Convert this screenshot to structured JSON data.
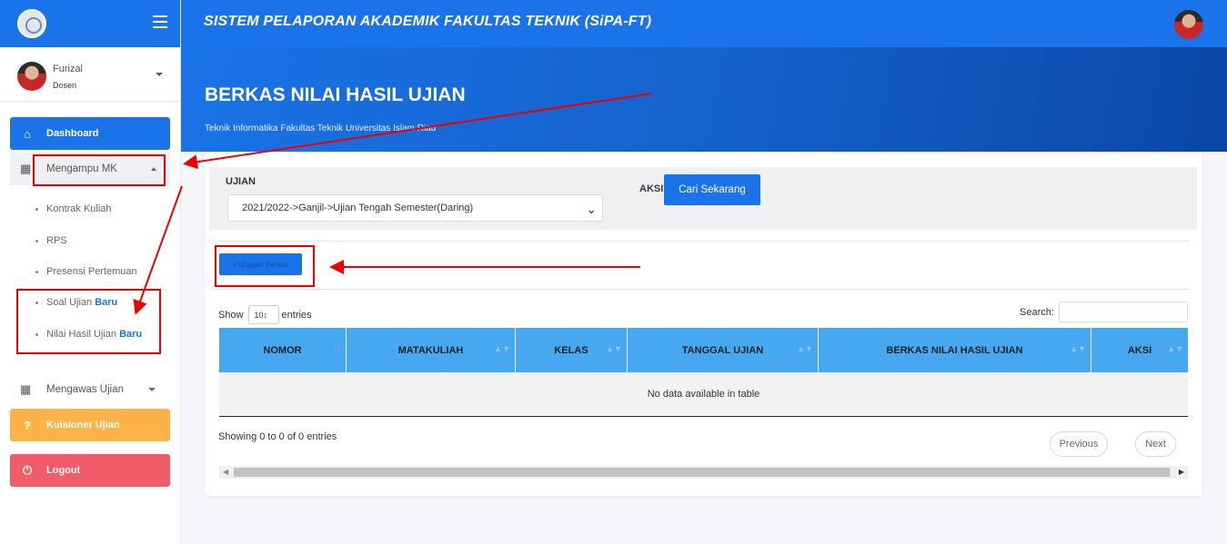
{
  "sidebar": {
    "user": {
      "name": "Furizal",
      "role": "Dosen"
    },
    "dashboard": "Dashboard",
    "mengampu": "Mengampu MK",
    "sub_items": [
      {
        "label": "Kontrak Kuliah"
      },
      {
        "label": "RPS"
      },
      {
        "label": "Presensi Pertemuan"
      },
      {
        "label": "Soal Ujian ",
        "badge": "Baru"
      },
      {
        "label": "Nilai Hasil Ujian ",
        "badge": "Baru"
      }
    ],
    "mengawas": "Mengawas Ujian",
    "kuisioner": "Kuisioner Ujian",
    "logout": "Logout"
  },
  "topbar": {
    "title": "SISTEM PELAPORAN AKADEMIK FAKULTAS TEKNIK (SiPA-FT)"
  },
  "header": {
    "title": "BERKAS NILAI HASIL UJIAN",
    "subtitle": "Teknik Informatika Fakultas Teknik Universitas Islam Riau"
  },
  "filter": {
    "ujian_label": "UJIAN",
    "ujian_value": "2021/2022->Ganjil->Ujian Tengah Semester(Daring)",
    "aksi_label": "AKSI",
    "search_button": "Cari Sekarang"
  },
  "upload_button": "Unggah Berkas",
  "table": {
    "show_label": "Show",
    "length_value": "10",
    "entries_label": "entries",
    "search_label": "Search:",
    "columns": [
      "NOMOR",
      "MATAKULIAH",
      "KELAS",
      "TANGGAL UJIAN",
      "BERKAS NILAI HASIL UJIAN",
      "AKSI"
    ],
    "empty_text": "No data available in table",
    "info": "Showing 0 to 0 of 0 entries",
    "prev": "Previous",
    "next": "Next"
  },
  "colors": {
    "primary": "#1a73e8",
    "warning": "#ffb246",
    "danger": "#f25b67",
    "annotation": "#e00000"
  }
}
